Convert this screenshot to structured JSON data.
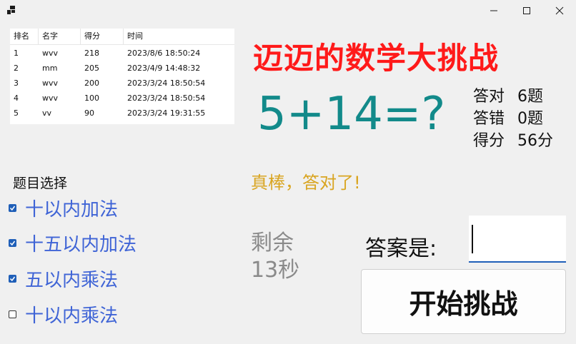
{
  "window": {
    "icons": {
      "app": "app-icon",
      "minimize": "minimize-icon",
      "maximize": "maximize-icon",
      "close": "close-icon"
    }
  },
  "leaderboard": {
    "columns": [
      "排名",
      "名字",
      "得分",
      "时间"
    ],
    "rows": [
      [
        "1",
        "wvv",
        "218",
        "2023/8/6 18:50:24"
      ],
      [
        "2",
        "mm",
        "205",
        "2023/4/9 14:48:32"
      ],
      [
        "3",
        "wvv",
        "200",
        "2023/3/24 18:50:54"
      ],
      [
        "4",
        "wvv",
        "100",
        "2023/3/24 18:50:54"
      ],
      [
        "5",
        "vv",
        "90",
        "2023/3/24 19:31:55"
      ]
    ]
  },
  "topic": {
    "label": "题目选择",
    "options": [
      {
        "label": "十以内加法",
        "checked": true
      },
      {
        "label": "十五以内加法",
        "checked": true
      },
      {
        "label": "五以内乘法",
        "checked": true
      },
      {
        "label": "十以内乘法",
        "checked": false
      }
    ]
  },
  "game": {
    "title": "迈迈的数学大挑战",
    "question": "5+14=?",
    "feedback": "真棒，答对了!",
    "timer_line1": "剩余",
    "timer_line2": "13秒",
    "answer_label": "答案是:",
    "answer_value": "",
    "start_button": "开始挑战",
    "colors": {
      "title": "#ff1a1a",
      "question": "#128a8a",
      "feedback": "#d9a521",
      "option": "#3f64d6"
    }
  },
  "stats": {
    "correct_label": "答对",
    "correct_value": "6题",
    "wrong_label": "答错",
    "wrong_value": "0题",
    "score_label": "得分",
    "score_value": "56分"
  }
}
